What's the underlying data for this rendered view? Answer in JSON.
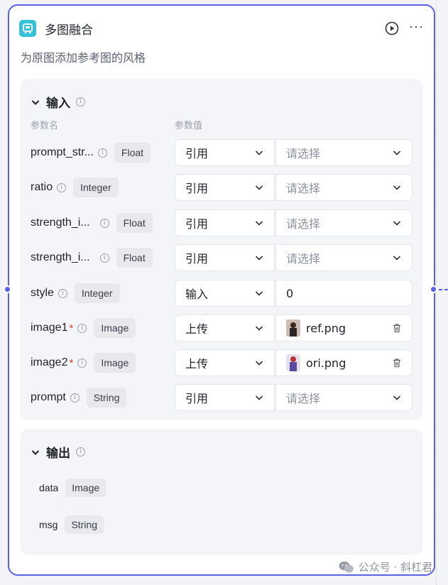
{
  "node": {
    "title": "多图融合",
    "description": "为原图添加参考图的风格",
    "icon": "node-type-icon",
    "accent_color": "#5a61e8",
    "icon_color": "#35c1d8"
  },
  "input_section": {
    "title": "输入",
    "col_name": "参数名",
    "col_value": "参数值",
    "params": [
      {
        "name": "prompt_str...",
        "type": "Float",
        "mode": "引用",
        "value": "请选择",
        "placeholder": true
      },
      {
        "name": "ratio",
        "type": "Integer",
        "mode": "引用",
        "value": "请选择",
        "placeholder": true
      },
      {
        "name": "strength_i...",
        "type": "Float",
        "mode": "引用",
        "value": "请选择",
        "placeholder": true
      },
      {
        "name": "strength_i...",
        "type": "Float",
        "mode": "引用",
        "value": "请选择",
        "placeholder": true
      },
      {
        "name": "style",
        "type": "Integer",
        "mode": "输入",
        "value": "0",
        "placeholder": false
      },
      {
        "name": "image1",
        "required": "*",
        "type": "Image",
        "mode": "上传",
        "value": "ref.png",
        "file": true
      },
      {
        "name": "image2",
        "required": "*",
        "type": "Image",
        "mode": "上传",
        "value": "ori.png",
        "file": true
      },
      {
        "name": "prompt",
        "type": "String",
        "mode": "引用",
        "value": "请选择",
        "placeholder": true
      }
    ]
  },
  "output_section": {
    "title": "输出",
    "outputs": [
      {
        "name": "data",
        "type": "Image"
      },
      {
        "name": "msg",
        "type": "String"
      }
    ]
  },
  "watermark": {
    "text": "公众号 · 斜杠君"
  }
}
